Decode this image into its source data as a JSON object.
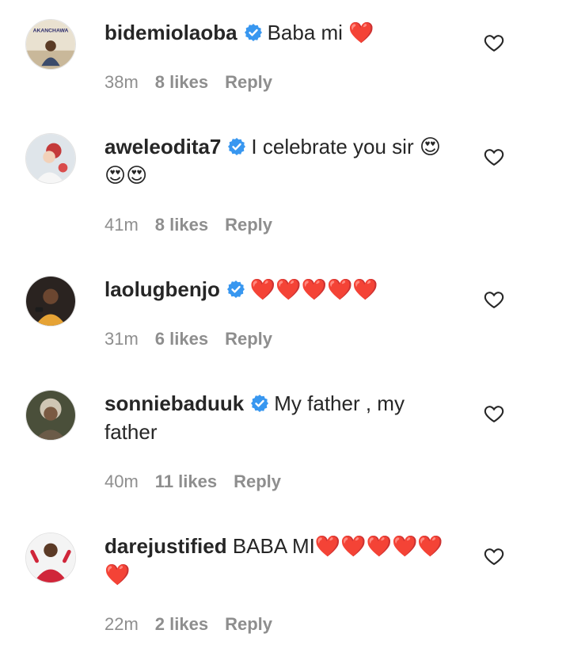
{
  "comments": [
    {
      "username": "bidemiolaoba",
      "text": "Baba mi ❤️",
      "time": "38m",
      "likes": "8 likes",
      "reply": "Reply",
      "avatar_text": "AKANCHAWA"
    },
    {
      "username": "aweleodita7",
      "text": "I celebrate you sir 😍😍😍",
      "time": "41m",
      "likes": "8 likes",
      "reply": "Reply"
    },
    {
      "username": "laolugbenjo",
      "text": "❤️❤️❤️❤️❤️",
      "time": "31m",
      "likes": "6 likes",
      "reply": "Reply"
    },
    {
      "username": "sonniebaduuk",
      "text": "My father , my father",
      "time": "40m",
      "likes": "11 likes",
      "reply": "Reply"
    },
    {
      "username": "darejustified",
      "text": "BABA MI❤️❤️❤️❤️❤️❤️",
      "time": "22m",
      "likes": "2 likes",
      "reply": "Reply"
    }
  ],
  "icons": {
    "verified_badge": "verified-badge-icon",
    "like": "heart-outline-icon"
  },
  "colors": {
    "verified": "#3897f0",
    "meta_text": "#8e8e8e",
    "primary_text": "#262626"
  }
}
